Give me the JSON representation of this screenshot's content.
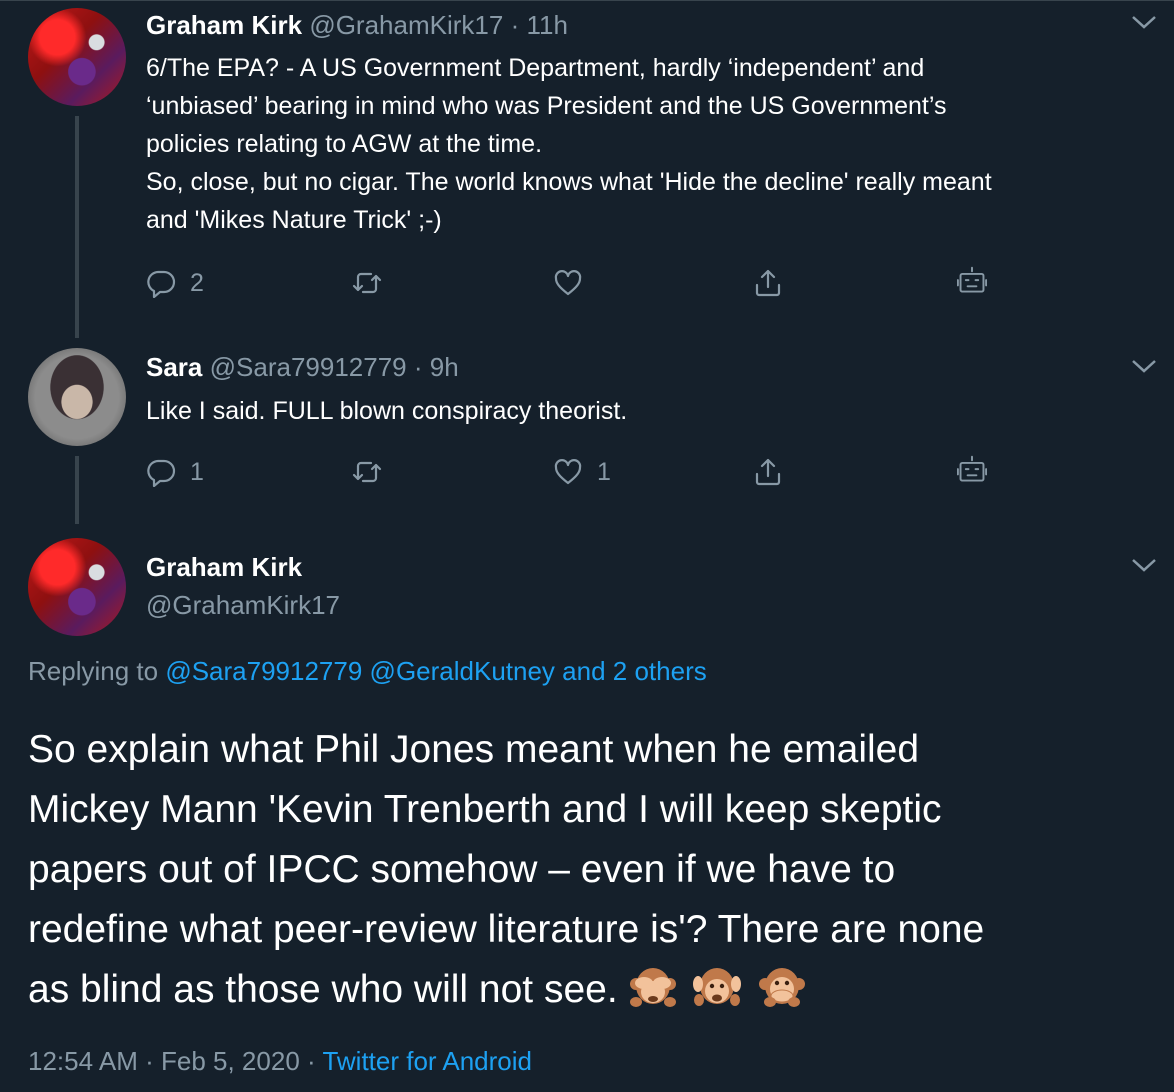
{
  "tweet1": {
    "name": "Graham Kirk",
    "handle": "@GrahamKirk17",
    "sep": "·",
    "time": "11h",
    "lines": [
      "6/The EPA? - A US Government Department, hardly ‘independent’ and",
      "‘unbiased’ bearing in mind who was President and the US Government’s",
      "policies relating to AGW at the time.",
      "So, close, but no cigar. The world knows what 'Hide the decline' really meant",
      "and 'Mikes Nature Trick' ;-)"
    ],
    "reply_count": "2",
    "retweet_count": "",
    "like_count": ""
  },
  "tweet2": {
    "name": "Sara",
    "handle": "@Sara79912779",
    "sep": "·",
    "time": "9h",
    "text": "Like I said. FULL blown conspiracy theorist.",
    "reply_count": "1",
    "retweet_count": "",
    "like_count": "1"
  },
  "main": {
    "name": "Graham Kirk",
    "handle": "@GrahamKirk17",
    "replying_prefix": "Replying to",
    "replying_user1": "@Sara79912779",
    "replying_user2": "@GeraldKutney",
    "replying_others": "and 2 others",
    "lines": [
      "So explain what Phil Jones meant when he emailed",
      "Mickey Mann 'Kevin Trenberth  and I will keep skeptic",
      "papers out of IPCC somehow – even if we have to",
      "redefine what peer-review literature is'? There are none",
      "as blind as those who will not see."
    ],
    "emojis": [
      "see-no-evil-monkey",
      "hear-no-evil-monkey",
      "speak-no-evil-monkey"
    ],
    "time": "12:54 AM",
    "sep1": "·",
    "date": "Feb 5, 2020",
    "sep2": "·",
    "source": "Twitter for Android"
  },
  "colors": {
    "background": "#15202b",
    "text": "#ffffff",
    "muted": "#8899a6",
    "link": "#1da1f2",
    "divider": "#38444d"
  },
  "icons": [
    "reply-icon",
    "retweet-icon",
    "like-icon",
    "share-icon",
    "analytics-bot-icon",
    "chevron-down-icon"
  ]
}
